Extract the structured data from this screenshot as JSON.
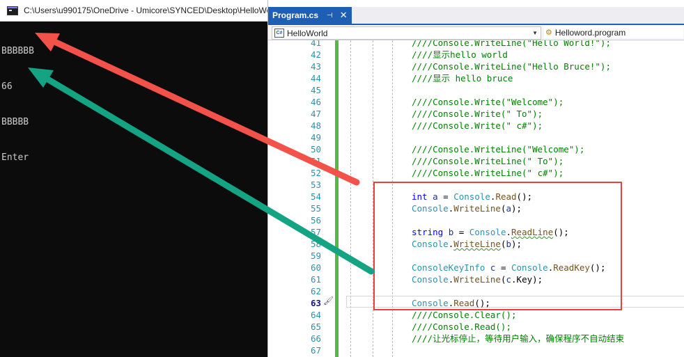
{
  "console": {
    "title": "C:\\Users\\u990175\\OneDrive - Umicore\\SYNCED\\Desktop\\HelloWo",
    "output": [
      "BBBBBB",
      "66",
      "BBBBB",
      "Enter"
    ]
  },
  "editor": {
    "tab": {
      "label": "Program.cs",
      "pin_glyph": "⊣",
      "close_glyph": "✕"
    },
    "nav": {
      "project": "HelloWorld",
      "class": "Helloword.program"
    },
    "current_line": "63",
    "lines": [
      {
        "n": "41",
        "parts": [
          {
            "c": "comment",
            "t": "////Console.WriteLine(\"Hello World!\");"
          }
        ]
      },
      {
        "n": "42",
        "parts": [
          {
            "c": "comment",
            "t": "////显示hello world"
          }
        ]
      },
      {
        "n": "43",
        "parts": [
          {
            "c": "comment",
            "t": "////Console.WriteLine(\"Hello Bruce!\");"
          }
        ]
      },
      {
        "n": "44",
        "parts": [
          {
            "c": "comment",
            "t": "////显示 hello bruce"
          }
        ]
      },
      {
        "n": "45",
        "parts": []
      },
      {
        "n": "46",
        "parts": [
          {
            "c": "comment",
            "t": "////Console.Write(\"Welcome\");"
          }
        ]
      },
      {
        "n": "47",
        "parts": [
          {
            "c": "comment",
            "t": "////Console.Write(\" To\");"
          }
        ]
      },
      {
        "n": "48",
        "parts": [
          {
            "c": "comment",
            "t": "////Console.Write(\" c#\");"
          }
        ]
      },
      {
        "n": "49",
        "parts": []
      },
      {
        "n": "50",
        "parts": [
          {
            "c": "comment",
            "t": "////Console.WriteLine(\"Welcome\");"
          }
        ]
      },
      {
        "n": "51",
        "parts": [
          {
            "c": "comment",
            "t": "////Console.WriteLine(\" To\");"
          }
        ]
      },
      {
        "n": "52",
        "parts": [
          {
            "c": "comment",
            "t": "////Console.WriteLine(\" c#\");"
          }
        ]
      },
      {
        "n": "53",
        "parts": []
      },
      {
        "n": "54",
        "parts": [
          {
            "c": "kw",
            "t": "int"
          },
          {
            "c": "plain",
            "t": " "
          },
          {
            "c": "id",
            "t": "a"
          },
          {
            "c": "plain",
            "t": " = "
          },
          {
            "c": "type",
            "t": "Console"
          },
          {
            "c": "plain",
            "t": "."
          },
          {
            "c": "method",
            "t": "Read"
          },
          {
            "c": "plain",
            "t": "();"
          }
        ]
      },
      {
        "n": "55",
        "parts": [
          {
            "c": "type",
            "t": "Console"
          },
          {
            "c": "plain",
            "t": "."
          },
          {
            "c": "method",
            "t": "WriteLine"
          },
          {
            "c": "plain",
            "t": "("
          },
          {
            "c": "id",
            "t": "a"
          },
          {
            "c": "plain",
            "t": ");"
          }
        ]
      },
      {
        "n": "56",
        "parts": []
      },
      {
        "n": "57",
        "parts": [
          {
            "c": "kw",
            "t": "string"
          },
          {
            "c": "plain",
            "t": " "
          },
          {
            "c": "id",
            "t": "b"
          },
          {
            "c": "plain",
            "t": " = "
          },
          {
            "c": "type",
            "t": "Console"
          },
          {
            "c": "plain",
            "t": "."
          },
          {
            "c": "method squiggle",
            "t": "ReadLine"
          },
          {
            "c": "plain",
            "t": "();"
          }
        ]
      },
      {
        "n": "58",
        "parts": [
          {
            "c": "type",
            "t": "Console"
          },
          {
            "c": "plain",
            "t": "."
          },
          {
            "c": "method squiggle",
            "t": "WriteLine"
          },
          {
            "c": "plain",
            "t": "("
          },
          {
            "c": "id",
            "t": "b"
          },
          {
            "c": "plain",
            "t": ");"
          }
        ]
      },
      {
        "n": "59",
        "parts": []
      },
      {
        "n": "60",
        "parts": [
          {
            "c": "type",
            "t": "ConsoleKeyInfo"
          },
          {
            "c": "plain",
            "t": " "
          },
          {
            "c": "id",
            "t": "c"
          },
          {
            "c": "plain",
            "t": " = "
          },
          {
            "c": "type",
            "t": "Console"
          },
          {
            "c": "plain",
            "t": "."
          },
          {
            "c": "method",
            "t": "ReadKey"
          },
          {
            "c": "plain",
            "t": "();"
          }
        ]
      },
      {
        "n": "61",
        "parts": [
          {
            "c": "type",
            "t": "Console"
          },
          {
            "c": "plain",
            "t": "."
          },
          {
            "c": "method",
            "t": "WriteLine"
          },
          {
            "c": "plain",
            "t": "("
          },
          {
            "c": "id",
            "t": "c"
          },
          {
            "c": "plain",
            "t": ".Key);"
          }
        ]
      },
      {
        "n": "62",
        "parts": []
      },
      {
        "n": "63",
        "parts": [
          {
            "c": "type",
            "t": "Console"
          },
          {
            "c": "plain",
            "t": "."
          },
          {
            "c": "method",
            "t": "Read"
          },
          {
            "c": "plain",
            "t": "();"
          }
        ]
      },
      {
        "n": "64",
        "parts": [
          {
            "c": "comment",
            "t": "////Console.Clear();"
          }
        ]
      },
      {
        "n": "65",
        "parts": [
          {
            "c": "comment",
            "t": "////Console.Read();"
          }
        ]
      },
      {
        "n": "66",
        "parts": [
          {
            "c": "comment",
            "t": "////让光标停止，等待用户输入，确保程序不自动结束"
          }
        ]
      },
      {
        "n": "67",
        "parts": []
      }
    ]
  },
  "colors": {
    "highlight_box": "#e8403a",
    "red_arrow": "#f2524a",
    "green_arrow": "#14a383"
  }
}
